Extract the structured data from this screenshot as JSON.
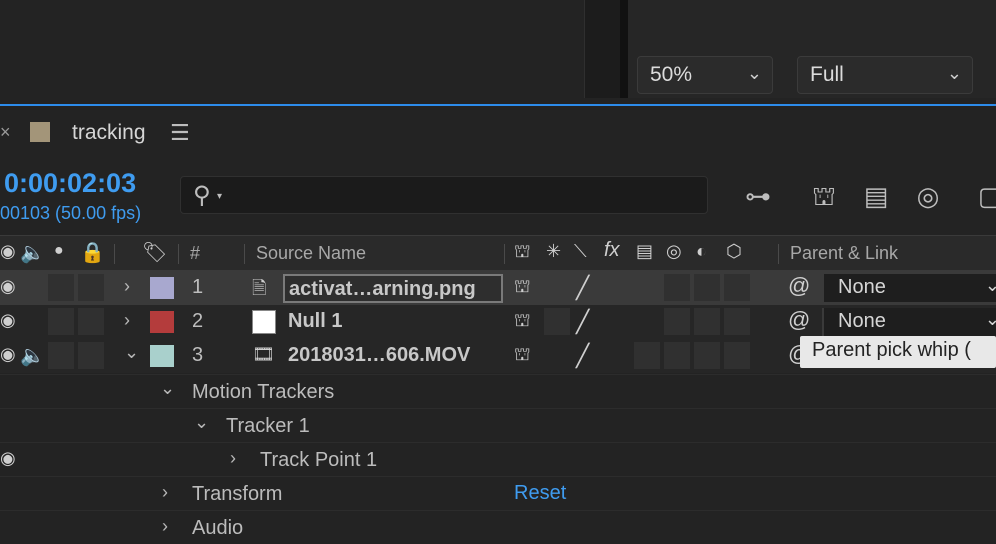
{
  "viewer": {
    "zoom_value": "50%",
    "resolution_value": "Full"
  },
  "composition": {
    "tab_title": "tracking",
    "tab_color": "#a39579",
    "timecode": "0:00:02:03",
    "frame_info": "00103 (50.00 fps)",
    "search_placeholder": ""
  },
  "columns": {
    "number": "#",
    "source_name": "Source Name",
    "parent_link": "Parent & Link"
  },
  "layers": [
    {
      "number": "1",
      "name": "activat…arning.png",
      "label_color": "#a8a8cf",
      "parent": "None",
      "expanded": false
    },
    {
      "number": "2",
      "name": "Null 1",
      "label_color": "#b43c3c",
      "parent": "None",
      "expanded": false
    },
    {
      "number": "3",
      "name": "2018031…606.MOV",
      "label_color": "#a9d0cc",
      "parent": "",
      "expanded": true
    }
  ],
  "properties": {
    "motion_trackers": "Motion Trackers",
    "tracker_1": "Tracker 1",
    "track_point_1": "Track Point 1",
    "transform": "Transform",
    "transform_reset": "Reset",
    "audio": "Audio"
  },
  "tooltip": "Parent pick whip (",
  "colors": {
    "accent": "#2d8ceb",
    "timecode": "#3f9cf0"
  }
}
